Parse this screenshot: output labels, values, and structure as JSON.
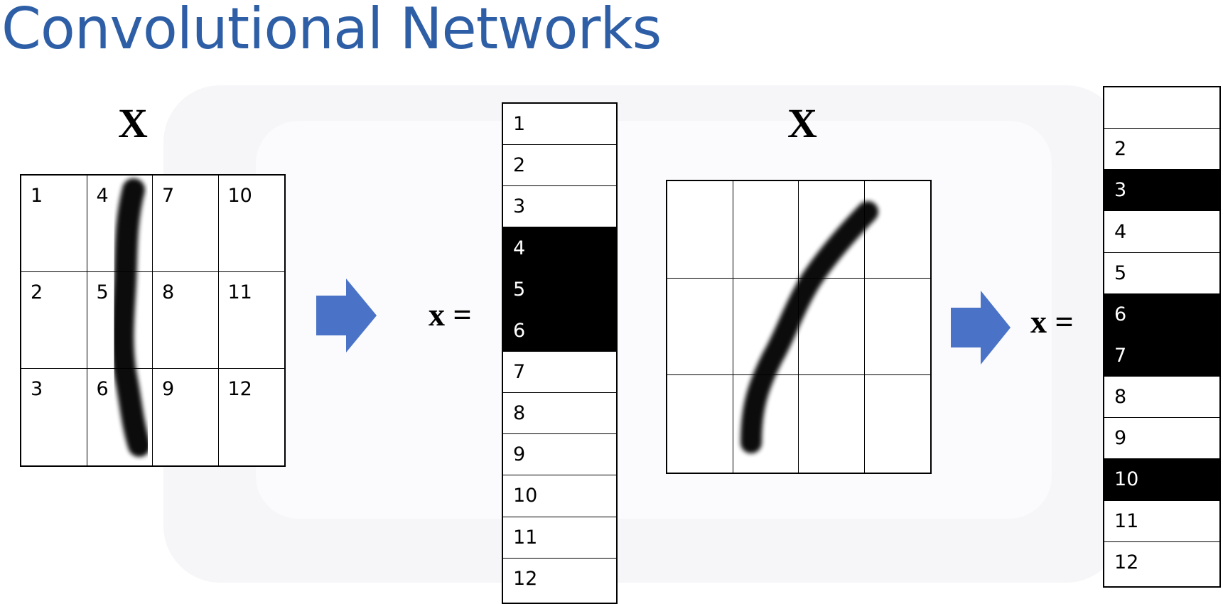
{
  "title": "Convolutional Networks",
  "left_panel": {
    "matrix_label": "X",
    "grid_cells": [
      [
        "1",
        "4",
        "7",
        "10"
      ],
      [
        "2",
        "5",
        "8",
        "11"
      ],
      [
        "3",
        "6",
        "9",
        "12"
      ]
    ],
    "equals_label": "x =",
    "vector": [
      {
        "label": "1",
        "on": false
      },
      {
        "label": "2",
        "on": false
      },
      {
        "label": "3",
        "on": false
      },
      {
        "label": "4",
        "on": true
      },
      {
        "label": "5",
        "on": true
      },
      {
        "label": "6",
        "on": true
      },
      {
        "label": "7",
        "on": false
      },
      {
        "label": "8",
        "on": false
      },
      {
        "label": "9",
        "on": false
      },
      {
        "label": "10",
        "on": false
      },
      {
        "label": "11",
        "on": false
      },
      {
        "label": "12",
        "on": false
      }
    ]
  },
  "right_panel": {
    "matrix_label": "X",
    "grid_cells": [
      [
        "",
        "",
        "",
        ""
      ],
      [
        "",
        "",
        "",
        ""
      ],
      [
        "",
        "",
        "",
        ""
      ]
    ],
    "equals_label": "x =",
    "vector": [
      {
        "label": "",
        "on": false
      },
      {
        "label": "2",
        "on": false
      },
      {
        "label": "3",
        "on": true
      },
      {
        "label": "4",
        "on": false
      },
      {
        "label": "5",
        "on": false
      },
      {
        "label": "6",
        "on": true
      },
      {
        "label": "7",
        "on": true
      },
      {
        "label": "8",
        "on": false
      },
      {
        "label": "9",
        "on": false
      },
      {
        "label": "10",
        "on": true
      },
      {
        "label": "11",
        "on": false
      },
      {
        "label": "12",
        "on": false
      }
    ]
  },
  "colors": {
    "title": "#2e5fa6",
    "arrow": "#4a73c8",
    "on_cell": "#000000",
    "stroke": "#000000"
  },
  "icons": {
    "arrow": "right-arrow-icon",
    "stroke": "handwritten-stroke"
  }
}
